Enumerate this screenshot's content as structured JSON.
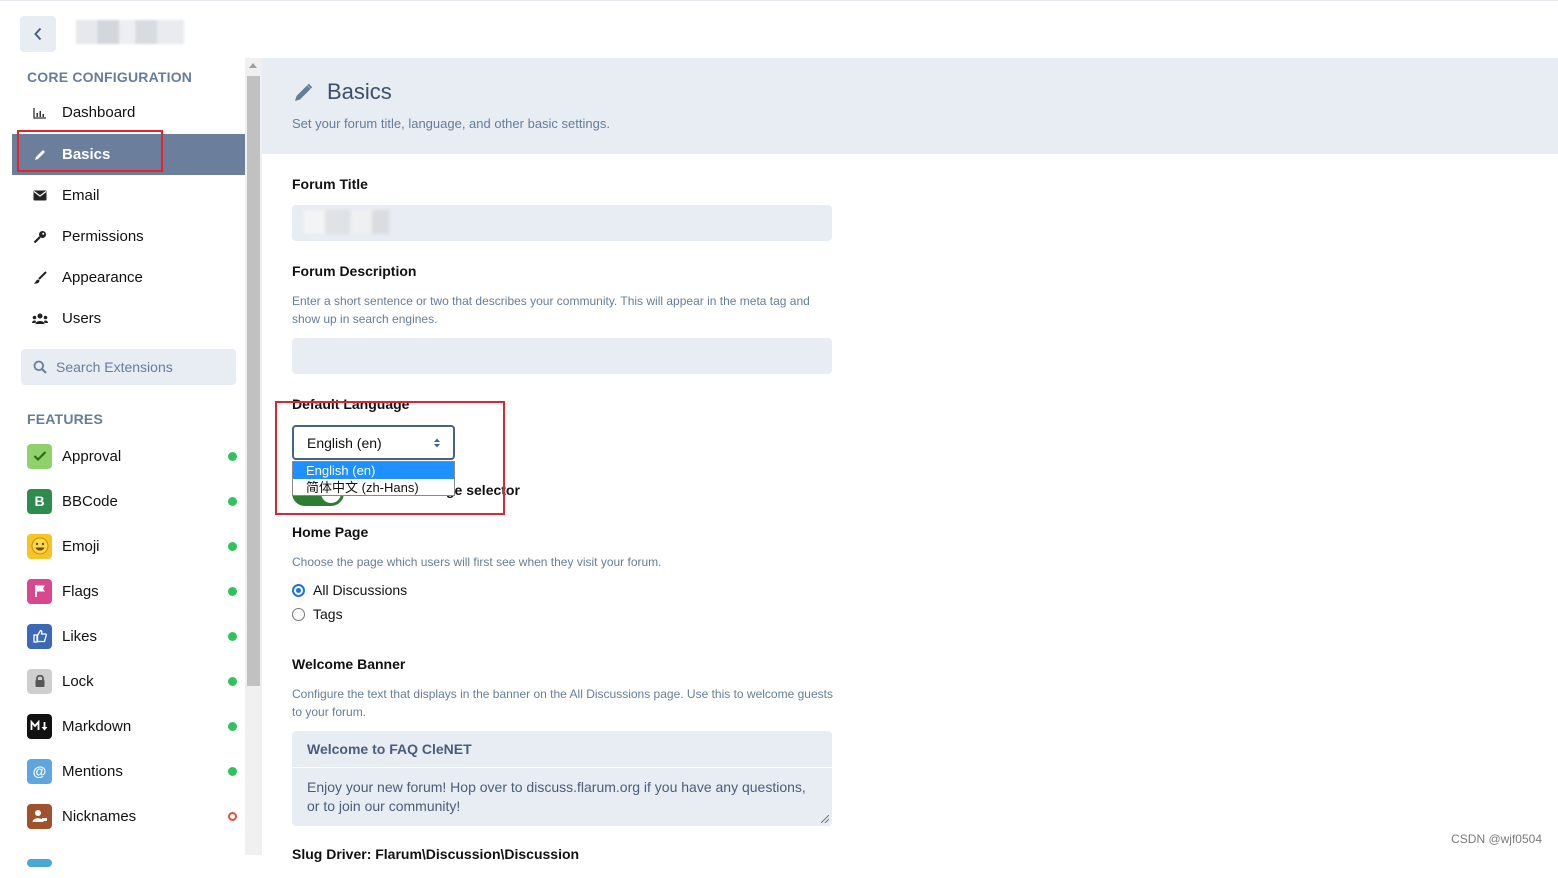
{
  "sidebar": {
    "core_heading": "CORE CONFIGURATION",
    "nav": [
      {
        "label": "Dashboard",
        "icon": "chart-icon"
      },
      {
        "label": "Basics",
        "icon": "pencil-icon",
        "active": true
      },
      {
        "label": "Email",
        "icon": "envelope-icon"
      },
      {
        "label": "Permissions",
        "icon": "key-icon"
      },
      {
        "label": "Appearance",
        "icon": "paintbrush-icon"
      },
      {
        "label": "Users",
        "icon": "users-icon"
      }
    ],
    "search_placeholder": "Search Extensions",
    "features_heading": "FEATURES",
    "extensions": [
      {
        "label": "Approval",
        "enabled": true,
        "color": "#8fd16a"
      },
      {
        "label": "BBCode",
        "enabled": true,
        "color": "#2e8b4e"
      },
      {
        "label": "Emoji",
        "enabled": true,
        "color": "#f7c325"
      },
      {
        "label": "Flags",
        "enabled": true,
        "color": "#d9488f"
      },
      {
        "label": "Likes",
        "enabled": true,
        "color": "#3b69b5"
      },
      {
        "label": "Lock",
        "enabled": true,
        "color": "#cfcfcf"
      },
      {
        "label": "Markdown",
        "enabled": true,
        "color": "#111111"
      },
      {
        "label": "Mentions",
        "enabled": true,
        "color": "#5fa5e0"
      },
      {
        "label": "Nicknames",
        "enabled": false,
        "color": "#a0522d"
      }
    ]
  },
  "page": {
    "title": "Basics",
    "description": "Set your forum title, language, and other basic settings."
  },
  "form": {
    "forum_title_label": "Forum Title",
    "forum_description_label": "Forum Description",
    "forum_description_help": "Enter a short sentence or two that describes your community. This will appear in the meta tag and show up in search engines.",
    "default_language_label": "Default Language",
    "default_language_value": "English (en)",
    "language_options": [
      "English (en)",
      "简体中文 (zh-Hans)"
    ],
    "language_selector_label": "ge selector",
    "home_page_label": "Home Page",
    "home_page_help": "Choose the page which users will first see when they visit your forum.",
    "home_page_options": [
      {
        "label": "All Discussions",
        "checked": true
      },
      {
        "label": "Tags",
        "checked": false
      }
    ],
    "welcome_banner_label": "Welcome Banner",
    "welcome_banner_help": "Configure the text that displays in the banner on the All Discussions page. Use this to welcome guests to your forum.",
    "welcome_banner_title": "Welcome to FAQ CleNET",
    "welcome_banner_text": "Enjoy your new forum! Hop over to discuss.flarum.org if you have any questions, or to join our community!",
    "next_label": "Slug Driver: Flarum\\Discussion\\Discussion"
  },
  "watermark": "CSDN @wjf0504",
  "colors": {
    "accent": "#6b7f9c",
    "highlight_box": "#e8212a",
    "enabled_dot": "#2fc45b"
  }
}
